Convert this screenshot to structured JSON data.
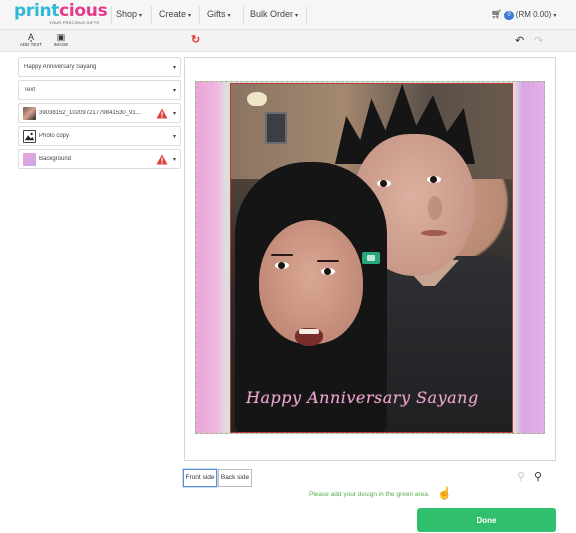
{
  "brand": {
    "logo_part1": "print",
    "logo_part2": "cious",
    "tagline": "YOUR PRECIOUS GIFTS"
  },
  "nav": {
    "items": [
      {
        "label": "Shop"
      },
      {
        "label": "Create"
      },
      {
        "label": "Gifts"
      },
      {
        "label": "Bulk Order"
      }
    ],
    "cart_count": "0",
    "cart_total": "(RM 0.00)"
  },
  "toolbar": {
    "add_text_label": "ADD TEXT",
    "image_label": "IMAGE"
  },
  "layers": [
    {
      "name": "Happy Anniversary Sayang",
      "warning": false,
      "thumb": "none"
    },
    {
      "name": "Text",
      "warning": false,
      "thumb": "none"
    },
    {
      "name": "39038152_10209721779841530_91...",
      "warning": true,
      "thumb": "photo"
    },
    {
      "name": "Photo copy",
      "warning": false,
      "thumb": "image-icon"
    },
    {
      "name": "Background",
      "warning": true,
      "thumb": "gradient"
    }
  ],
  "canvas": {
    "caption": "Happy Anniversary Sayang"
  },
  "bottom": {
    "front_side": "Front side",
    "back_side": "Back side",
    "hint": "Please add your design in the green area.",
    "done": "Done"
  },
  "colors": {
    "brand_blue": "#2fb9d6",
    "brand_pink": "#e53a8a",
    "done_green": "#2fbf6d",
    "warning_red": "#e0403a",
    "refresh_red": "#e03a2e",
    "caption_pink": "#e7a9cf"
  },
  "icons": {
    "cart": "cart-icon",
    "refresh": "refresh-icon",
    "undo": "undo-icon",
    "redo": "redo-icon",
    "zoom_out": "zoom-out-icon",
    "zoom_in": "zoom-in-icon",
    "hand": "hand-pointer-icon",
    "warning": "warning-icon"
  }
}
